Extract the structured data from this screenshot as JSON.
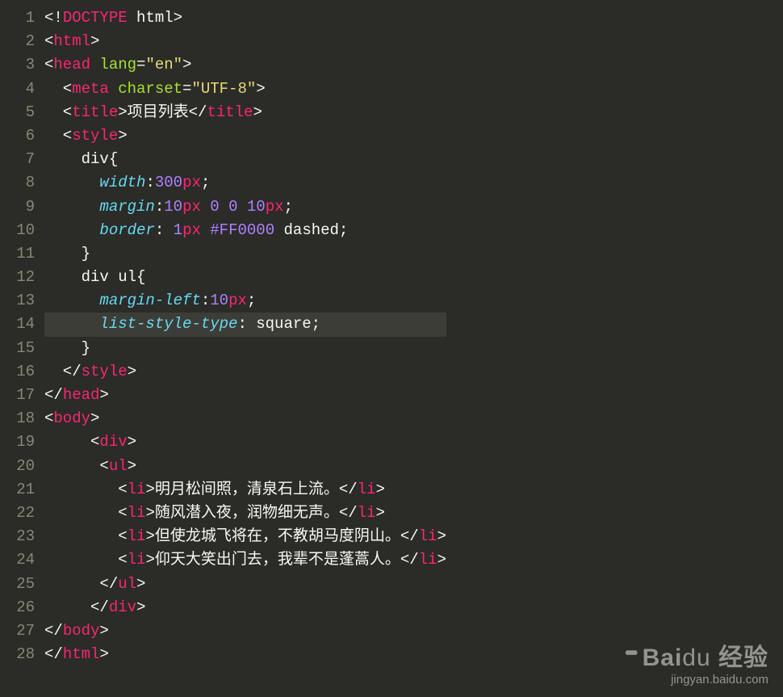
{
  "lines": [
    {
      "n": "1",
      "tokens": [
        [
          "c-white",
          "<!"
        ],
        [
          "c-red",
          "DOCTYPE"
        ],
        [
          "c-white",
          " html>"
        ]
      ]
    },
    {
      "n": "2",
      "tokens": [
        [
          "c-white",
          "<"
        ],
        [
          "c-red",
          "html"
        ],
        [
          "c-white",
          ">"
        ]
      ]
    },
    {
      "n": "3",
      "tokens": [
        [
          "c-white",
          "<"
        ],
        [
          "c-red",
          "head"
        ],
        [
          "c-green",
          " lang"
        ],
        [
          "c-white",
          "="
        ],
        [
          "c-yellow",
          "\"en\""
        ],
        [
          "c-white",
          ">"
        ]
      ]
    },
    {
      "n": "4",
      "tokens": [
        [
          "c-white",
          "  <"
        ],
        [
          "c-red",
          "meta"
        ],
        [
          "c-green",
          " charset"
        ],
        [
          "c-white",
          "="
        ],
        [
          "c-yellow",
          "\"UTF-8\""
        ],
        [
          "c-white",
          ">"
        ]
      ]
    },
    {
      "n": "5",
      "tokens": [
        [
          "c-white",
          "  <"
        ],
        [
          "c-red",
          "title"
        ],
        [
          "c-white",
          ">项目列表</"
        ],
        [
          "c-red",
          "title"
        ],
        [
          "c-white",
          ">"
        ]
      ]
    },
    {
      "n": "6",
      "tokens": [
        [
          "c-white",
          "  <"
        ],
        [
          "c-red",
          "style"
        ],
        [
          "c-white",
          ">"
        ]
      ]
    },
    {
      "n": "7",
      "tokens": [
        [
          "c-white",
          "    div{"
        ]
      ]
    },
    {
      "n": "8",
      "tokens": [
        [
          "c-white",
          "      "
        ],
        [
          "c-blue",
          "width"
        ],
        [
          "c-white",
          ":"
        ],
        [
          "c-purple",
          "300"
        ],
        [
          "c-red",
          "px"
        ],
        [
          "c-white",
          ";"
        ]
      ]
    },
    {
      "n": "9",
      "tokens": [
        [
          "c-white",
          "      "
        ],
        [
          "c-blue",
          "margin"
        ],
        [
          "c-white",
          ":"
        ],
        [
          "c-purple",
          "10"
        ],
        [
          "c-red",
          "px"
        ],
        [
          "c-white",
          " "
        ],
        [
          "c-purple",
          "0"
        ],
        [
          "c-white",
          " "
        ],
        [
          "c-purple",
          "0"
        ],
        [
          "c-white",
          " "
        ],
        [
          "c-purple",
          "10"
        ],
        [
          "c-red",
          "px"
        ],
        [
          "c-white",
          ";"
        ]
      ]
    },
    {
      "n": "10",
      "tokens": [
        [
          "c-white",
          "      "
        ],
        [
          "c-blue",
          "border"
        ],
        [
          "c-white",
          ": "
        ],
        [
          "c-purple",
          "1"
        ],
        [
          "c-red",
          "px"
        ],
        [
          "c-white",
          " "
        ],
        [
          "c-purple",
          "#FF0000"
        ],
        [
          "c-white",
          " dashed;"
        ]
      ]
    },
    {
      "n": "11",
      "tokens": [
        [
          "c-white",
          "    }"
        ]
      ]
    },
    {
      "n": "12",
      "tokens": [
        [
          "c-white",
          "    div ul{"
        ]
      ]
    },
    {
      "n": "13",
      "tokens": [
        [
          "c-white",
          "      "
        ],
        [
          "c-blue",
          "margin-left"
        ],
        [
          "c-white",
          ":"
        ],
        [
          "c-purple",
          "10"
        ],
        [
          "c-red",
          "px"
        ],
        [
          "c-white",
          ";"
        ]
      ]
    },
    {
      "n": "14",
      "hl": true,
      "tokens": [
        [
          "c-white",
          "      "
        ],
        [
          "c-blue",
          "list-style-type"
        ],
        [
          "c-white",
          ": square;"
        ]
      ]
    },
    {
      "n": "15",
      "tokens": [
        [
          "c-white",
          "    }"
        ]
      ]
    },
    {
      "n": "16",
      "tokens": [
        [
          "c-white",
          "  </"
        ],
        [
          "c-red",
          "style"
        ],
        [
          "c-white",
          ">"
        ]
      ]
    },
    {
      "n": "17",
      "tokens": [
        [
          "c-white",
          "</"
        ],
        [
          "c-red",
          "head"
        ],
        [
          "c-white",
          ">"
        ]
      ]
    },
    {
      "n": "18",
      "tokens": [
        [
          "c-white",
          "<"
        ],
        [
          "c-red",
          "body"
        ],
        [
          "c-white",
          ">"
        ]
      ]
    },
    {
      "n": "19",
      "tokens": [
        [
          "c-white",
          "     <"
        ],
        [
          "c-red",
          "div"
        ],
        [
          "c-white",
          ">"
        ]
      ]
    },
    {
      "n": "20",
      "tokens": [
        [
          "c-white",
          "      <"
        ],
        [
          "c-red",
          "ul"
        ],
        [
          "c-white",
          ">"
        ]
      ]
    },
    {
      "n": "21",
      "tokens": [
        [
          "c-white",
          "        <"
        ],
        [
          "c-red",
          "li"
        ],
        [
          "c-white",
          ">明月松间照，清泉石上流。</"
        ],
        [
          "c-red",
          "li"
        ],
        [
          "c-white",
          ">"
        ]
      ]
    },
    {
      "n": "22",
      "tokens": [
        [
          "c-white",
          "        <"
        ],
        [
          "c-red",
          "li"
        ],
        [
          "c-white",
          ">随风潜入夜，润物细无声。</"
        ],
        [
          "c-red",
          "li"
        ],
        [
          "c-white",
          ">"
        ]
      ]
    },
    {
      "n": "23",
      "tokens": [
        [
          "c-white",
          "        <"
        ],
        [
          "c-red",
          "li"
        ],
        [
          "c-white",
          ">但使龙城飞将在，不教胡马度阴山。</"
        ],
        [
          "c-red",
          "li"
        ],
        [
          "c-white",
          ">"
        ]
      ]
    },
    {
      "n": "24",
      "tokens": [
        [
          "c-white",
          "        <"
        ],
        [
          "c-red",
          "li"
        ],
        [
          "c-white",
          ">仰天大笑出门去，我辈不是蓬蒿人。</"
        ],
        [
          "c-red",
          "li"
        ],
        [
          "c-white",
          ">"
        ]
      ]
    },
    {
      "n": "25",
      "tokens": [
        [
          "c-white",
          "      </"
        ],
        [
          "c-red",
          "ul"
        ],
        [
          "c-white",
          ">"
        ]
      ]
    },
    {
      "n": "26",
      "tokens": [
        [
          "c-white",
          "     </"
        ],
        [
          "c-red",
          "div"
        ],
        [
          "c-white",
          ">"
        ]
      ]
    },
    {
      "n": "27",
      "tokens": [
        [
          "c-white",
          "</"
        ],
        [
          "c-red",
          "body"
        ],
        [
          "c-white",
          ">"
        ]
      ]
    },
    {
      "n": "28",
      "tokens": [
        [
          "c-white",
          "</"
        ],
        [
          "c-red",
          "html"
        ],
        [
          "c-white",
          ">"
        ]
      ]
    }
  ],
  "watermark": {
    "logo": "Bai",
    "logo2": "经验",
    "sub": "jingyan.baidu.com"
  }
}
